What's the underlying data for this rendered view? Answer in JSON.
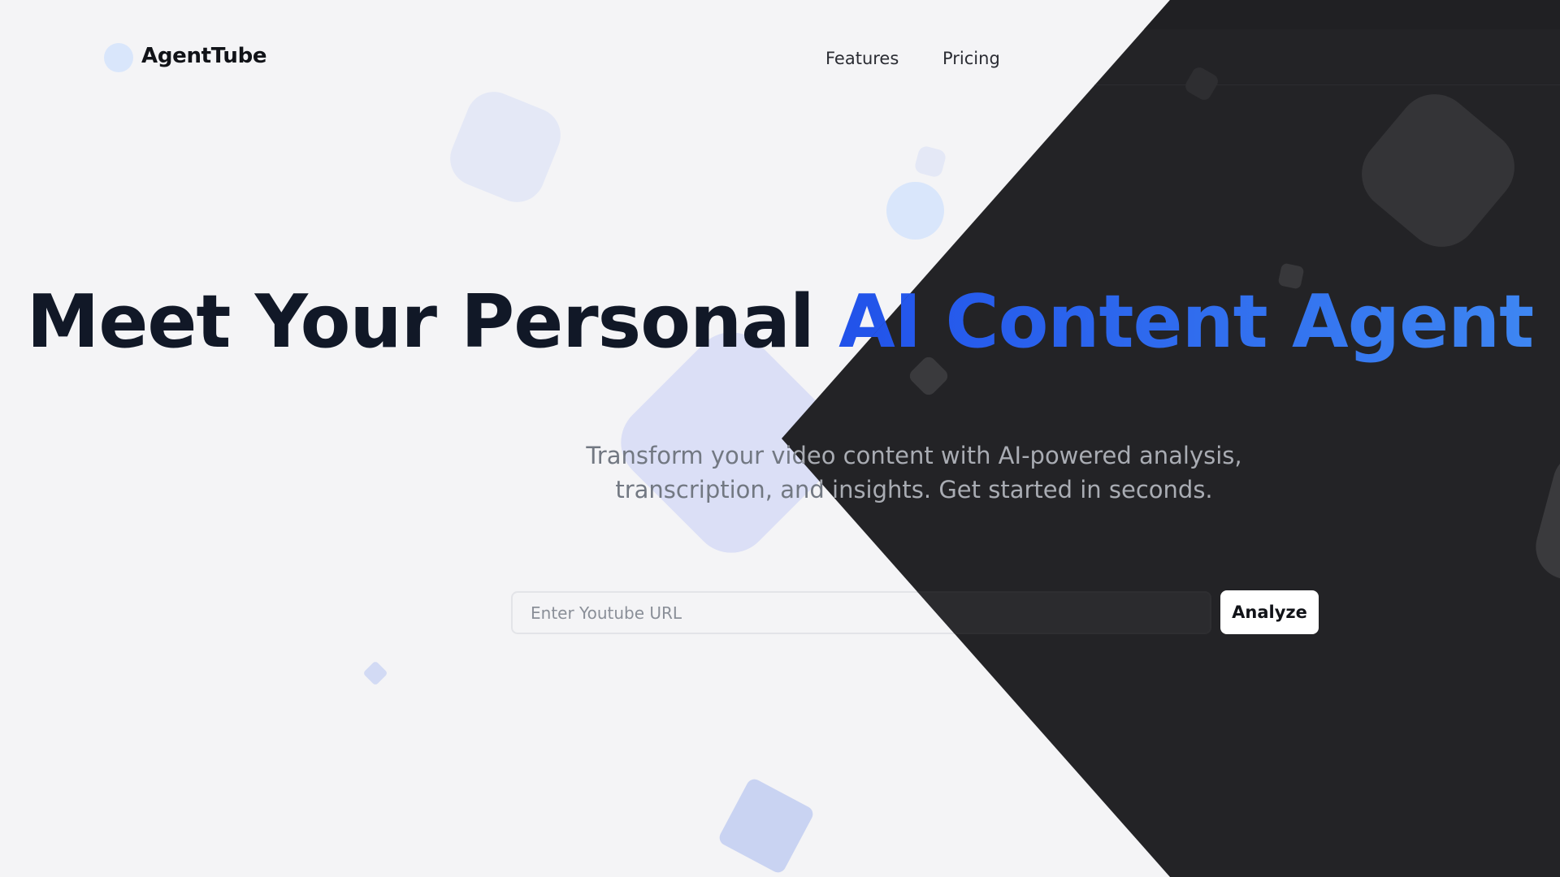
{
  "header": {
    "brand": "AgentTube",
    "nav": [
      {
        "label": "Features"
      },
      {
        "label": "Pricing"
      }
    ]
  },
  "hero": {
    "title_plain": "Meet Your Personal ",
    "title_accent": "AI Content Agent",
    "subtitle": "Transform your video content with AI-powered analysis, transcription, and insights. Get started in seconds."
  },
  "search": {
    "placeholder": "Enter Youtube URL",
    "value": "",
    "button_label": "Analyze"
  },
  "theme": {
    "light_background": "#f4f4f6",
    "dark_background": "#232326",
    "accent_start": "#2152ea",
    "accent_end": "#3e86f2"
  }
}
